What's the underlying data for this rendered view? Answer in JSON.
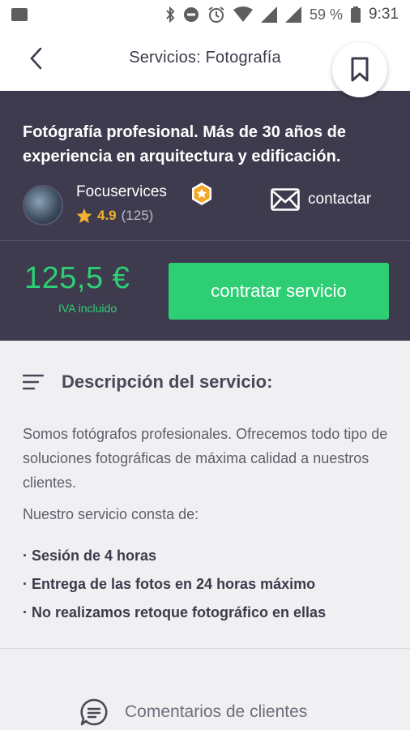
{
  "status_bar": {
    "battery": "59 %",
    "time": "9:31"
  },
  "app_bar": {
    "title": "Servicios: Fotografía"
  },
  "provider": {
    "headline": "Fotógrafía profesional. Más de 30 años de experiencia en arquitectura y edificación.",
    "name": "Focuservices",
    "rating": "4.9",
    "review_count": "(125)",
    "contact_label": "contactar"
  },
  "pricing": {
    "price": "125,5 €",
    "vat_note": "IVA incluido",
    "hire_button": "contratar servicio"
  },
  "description": {
    "title": "Descripción del servicio:",
    "text": "Somos fotógrafos profesionales. Ofrecemos todo tipo de soluciones fotográficas de máxima calidad a nuestros clientes.",
    "subtitle": "Nuestro servicio consta de:",
    "bullets": [
      "· Sesión de 4 horas",
      "· Entrega de las fotos en 24 horas máximo",
      "· No realizamos retoque fotográfico en ellas"
    ]
  },
  "comments": {
    "label": "Comentarios de clientes"
  },
  "colors": {
    "panel": "#3f3b4e",
    "accent_green": "#2ecf74",
    "rating_star": "#f2b12e",
    "badge_orange": "#f5a623"
  },
  "icons": [
    "image-icon",
    "bluetooth-icon",
    "dnd-icon",
    "alarm-icon",
    "wifi-icon",
    "signal-icon",
    "battery-icon",
    "back-arrow-icon",
    "bookmark-icon",
    "verified-badge-icon",
    "star-icon",
    "mail-icon",
    "menu-lines-icon",
    "chat-bubble-icon"
  ]
}
